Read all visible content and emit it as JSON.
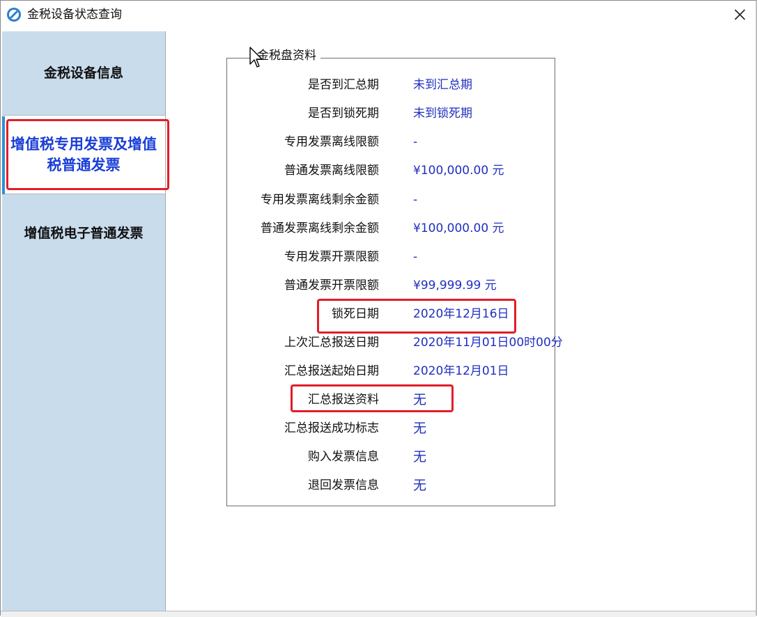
{
  "window": {
    "title": "金税设备状态查询"
  },
  "sidebar": {
    "items": [
      {
        "label": "金税设备信息"
      },
      {
        "label": "增值税专用发票及增值税普通发票"
      },
      {
        "label": "增值税电子普通发票"
      }
    ]
  },
  "group": {
    "legend": "金税盘资料",
    "rows": [
      {
        "label": "是否到汇总期",
        "value": "未到汇总期"
      },
      {
        "label": "是否到锁死期",
        "value": "未到锁死期"
      },
      {
        "label": "专用发票离线限额",
        "value": "-"
      },
      {
        "label": "普通发票离线限额",
        "value": "¥100,000.00 元"
      },
      {
        "label": "专用发票离线剩余金额",
        "value": "-"
      },
      {
        "label": "普通发票离线剩余金额",
        "value": "¥100,000.00 元"
      },
      {
        "label": "专用发票开票限额",
        "value": "-"
      },
      {
        "label": "普通发票开票限额",
        "value": "¥99,999.99 元"
      },
      {
        "label": "锁死日期",
        "value": "2020年12月16日"
      },
      {
        "label": "上次汇总报送日期",
        "value": "2020年11月01日00时00分"
      },
      {
        "label": "汇总报送起始日期",
        "value": "2020年12月01日"
      },
      {
        "label": "汇总报送资料",
        "value": "无"
      },
      {
        "label": "汇总报送成功标志",
        "value": "无"
      },
      {
        "label": "购入发票信息",
        "value": "无"
      },
      {
        "label": "退回发票信息",
        "value": "无"
      }
    ]
  },
  "icons": {
    "app": "app-logo-icon",
    "close": "close-icon",
    "cursor": "mouse-cursor-icon"
  },
  "colors": {
    "sidebar_bg": "#c9dcec",
    "selected_text": "#1a3ed6",
    "value_text": "#1f2fbf",
    "highlight_border": "#e21d2a",
    "accent": "#2f8fd6"
  }
}
